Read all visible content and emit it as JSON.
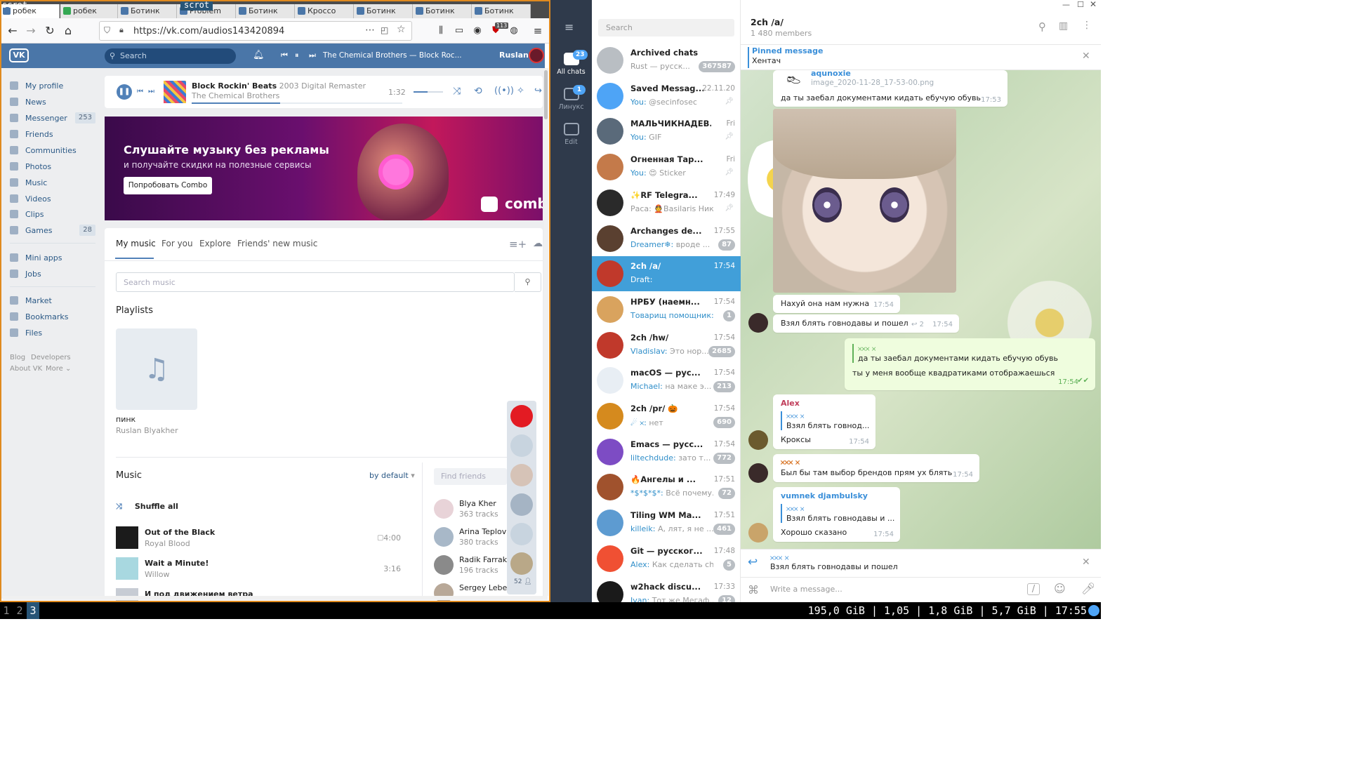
{
  "scrot": {
    "label": "scrot",
    "label2": "scrot"
  },
  "browser": {
    "tabs": [
      "Ботинк",
      "Problem",
      "Ботинк",
      "Кроссо",
      "Ботинк",
      "Ботинк",
      "Ботинк"
    ],
    "first_tab": "робек",
    "url": "https://vk.com/audios143420894",
    "notif_count": "113"
  },
  "vk": {
    "logo": "VK",
    "search_placeholder": "Search",
    "player_title": "The Chemical Brothers — Block Roc...",
    "user": "Ruslan",
    "menu": [
      {
        "label": "My profile",
        "icon": "user-icon"
      },
      {
        "label": "News",
        "icon": "news-icon"
      },
      {
        "label": "Messenger",
        "icon": "chat-icon",
        "badge": "253"
      },
      {
        "label": "Friends",
        "icon": "friend-icon"
      },
      {
        "label": "Communities",
        "icon": "community-icon"
      },
      {
        "label": "Photos",
        "icon": "camera-icon"
      },
      {
        "label": "Music",
        "icon": "music-icon"
      },
      {
        "label": "Videos",
        "icon": "video-icon"
      },
      {
        "label": "Clips",
        "icon": "clips-icon"
      },
      {
        "label": "Games",
        "icon": "gamepad-icon",
        "badge": "28"
      },
      {
        "label": "Mini apps",
        "icon": "apps-icon"
      },
      {
        "label": "Jobs",
        "icon": "briefcase-icon"
      },
      {
        "label": "Market",
        "icon": "bag-icon"
      },
      {
        "label": "Bookmarks",
        "icon": "star-icon"
      },
      {
        "label": "Files",
        "icon": "file-icon"
      }
    ],
    "footer": {
      "blog": "Blog",
      "developers": "Developers",
      "about": "About VK",
      "more": "More"
    },
    "now_playing": {
      "title": "Block Rockin' Beats",
      "suffix": "2003 Digital Remaster",
      "artist": "The Chemical Brothers",
      "time": "1:32",
      "progress": 0.42
    },
    "banner": {
      "title": "Слушайте музыку без рекламы",
      "subtitle": "и получайте скидки на полезные сервисы",
      "button": "Попробовать Combo",
      "logo": "combo"
    },
    "tabs": [
      "My music",
      "For you",
      "Explore",
      "Friends' new music"
    ],
    "search_music_placeholder": "Search music",
    "playlists_title": "Playlists",
    "playlist": {
      "name": "пинк",
      "owner": "Ruslan Blyakher"
    },
    "music_title": "Music",
    "sort": "by default",
    "find_friends": "Find friends",
    "shuffle": "Shuffle all",
    "tracks": [
      {
        "title": "Out of the Black",
        "artist": "Royal Blood",
        "duration": "4:00"
      },
      {
        "title": "Wait a Minute!",
        "artist": "Willow",
        "duration": "3:16"
      },
      {
        "title": "И под движением ветра",
        "artist": "",
        "duration": ""
      }
    ],
    "friends": [
      {
        "name": "Blya Kher",
        "tracks": "363 tracks"
      },
      {
        "name": "Arina Teplova",
        "tracks": "380 tracks"
      },
      {
        "name": "Radik Farrakho",
        "tracks": "196 tracks"
      },
      {
        "name": "Sergey Lebede",
        "tracks": ""
      }
    ],
    "strip_count": "52"
  },
  "telegram": {
    "folders": [
      {
        "label": "All chats",
        "badge": "23"
      },
      {
        "label": "Линукс",
        "badge": "1"
      },
      {
        "label": "Edit",
        "badge": ""
      }
    ],
    "search_placeholder": "Search",
    "chats": [
      {
        "name": "Archived chats",
        "time": "",
        "who": "",
        "preview": "Rust — русск...",
        "badge": "367587",
        "color": "#b9bec3"
      },
      {
        "name": "Saved Messag...",
        "time": "22.11.20",
        "who": "You:",
        "preview": "@secinfosec",
        "badge": "",
        "pin": true,
        "color": "#4ea4f6"
      },
      {
        "name": "МАЛЬЧИКНАДЕВ...",
        "time": "Fri",
        "who": "You:",
        "preview": "GIF",
        "badge": "",
        "pin": true,
        "color": "#5a6a7a"
      },
      {
        "name": "Огненная Тар...",
        "time": "Fri",
        "who": "You:",
        "preview": "😍 Sticker",
        "badge": "",
        "pin": true,
        "color": "#c47a4a"
      },
      {
        "name": "✨RF Telegra...",
        "time": "17:49",
        "who": "",
        "preview": "Раса: 👲Basilaris Ник...",
        "badge": "",
        "pin": true,
        "color": "#2a2a2a"
      },
      {
        "name": "Archanges de...",
        "time": "17:55",
        "who": "Dreamer❄:",
        "preview": "вроде ...",
        "badge": "87",
        "color": "#5a4030"
      },
      {
        "name": "2ch /a/",
        "time": "17:54",
        "who": "",
        "preview": "Draft:",
        "badge": "",
        "active": true,
        "color": "#c0392b"
      },
      {
        "name": "НРБУ (наемн...",
        "time": "17:54",
        "who": "Товарищ помощник:",
        "preview": "",
        "badge": "1",
        "color": "#d9a35e"
      },
      {
        "name": "2ch /hw/",
        "time": "17:54",
        "who": "Vladislav:",
        "preview": "Это нор...",
        "badge": "2685",
        "color": "#c0392b"
      },
      {
        "name": "macOS — рус...",
        "time": "17:54",
        "who": "Michael:",
        "preview": "на маке э...",
        "badge": "213",
        "color": "#e8eef4"
      },
      {
        "name": "2ch /pr/ 🎃",
        "time": "17:54",
        "who": "☄ 𐄂:",
        "preview": "нет",
        "badge": "690",
        "color": "#d58a1e"
      },
      {
        "name": "Emacs — русс...",
        "time": "17:54",
        "who": "liltechdude:",
        "preview": "зато т...",
        "badge": "772",
        "color": "#7d4cc4"
      },
      {
        "name": "🔥Ангелы и ...",
        "time": "17:51",
        "who": "*$*$*$*:",
        "preview": "Всё почему...",
        "badge": "72",
        "color": "#a0522d"
      },
      {
        "name": "Tiling WM Ma...",
        "time": "17:51",
        "who": "killeik:",
        "preview": "А, лят, я не ...",
        "badge": "461",
        "color": "#5d9bd1"
      },
      {
        "name": "Git — русског...",
        "time": "17:48",
        "who": "Alex:",
        "preview": "Как сделать ch...",
        "badge": "5",
        "color": "#f05033"
      },
      {
        "name": "w2hack discu...",
        "time": "17:33",
        "who": "Ivan:",
        "preview": "Тот же Мегаф...",
        "badge": "12",
        "color": "#1a1a1a"
      }
    ],
    "header": {
      "title": "2ch /a/",
      "members": "1 480 members"
    },
    "pinned": {
      "label": "Pinned message",
      "text": "Хентач"
    },
    "messages": {
      "file_author": "aqunoxie",
      "file_name": "image_2020-11-28_17-53-00.png",
      "m1": "да ты заебал документами кидать ебучую обувь",
      "m1_time": "17:53",
      "m2": "Нахуй она нам нужна",
      "m2_time": "17:54",
      "m3": "Взял блять говнодавы и пошел",
      "m3_replies": "2",
      "m3_time": "17:54",
      "out_reply_name": "𐄂𐄂𐄂 𐄂",
      "out_reply_text": "да ты заебал документами кидать ебучую обувь",
      "out_text": "ты у меня вообще квадратиками отображаешься",
      "out_time": "17:54",
      "alex_name": "Alex",
      "alex_reply_name": "𐄂𐄂𐄂 𐄂",
      "alex_reply_text": "Взял блять говнод...",
      "alex_text": "Кроксы",
      "alex_time": "17:54",
      "m4_name": "𐄂𐄂𐄂 𐄂",
      "m4_text": "Был бы там выбор брендов прям ух блять",
      "m4_time": "17:54",
      "vum_name": "vumnek djambulsky",
      "vum_reply_name": "𐄂𐄂𐄂 𐄂",
      "vum_reply_text": "Взял блять говнодавы и ...",
      "vum_text": "Хорошо сказано",
      "vum_time": "17:54"
    },
    "reply_bar": {
      "name": "𐄂𐄂𐄂 𐄂",
      "text": "Взял блять говнодавы и пошел"
    },
    "input_placeholder": "Write a message..."
  },
  "panel": {
    "workspaces": [
      "1",
      "2",
      "3"
    ],
    "active": "3",
    "status": "195,0 GiB | 1,05 | 1,8 GiB | 5,7 GiB | 17:55"
  }
}
